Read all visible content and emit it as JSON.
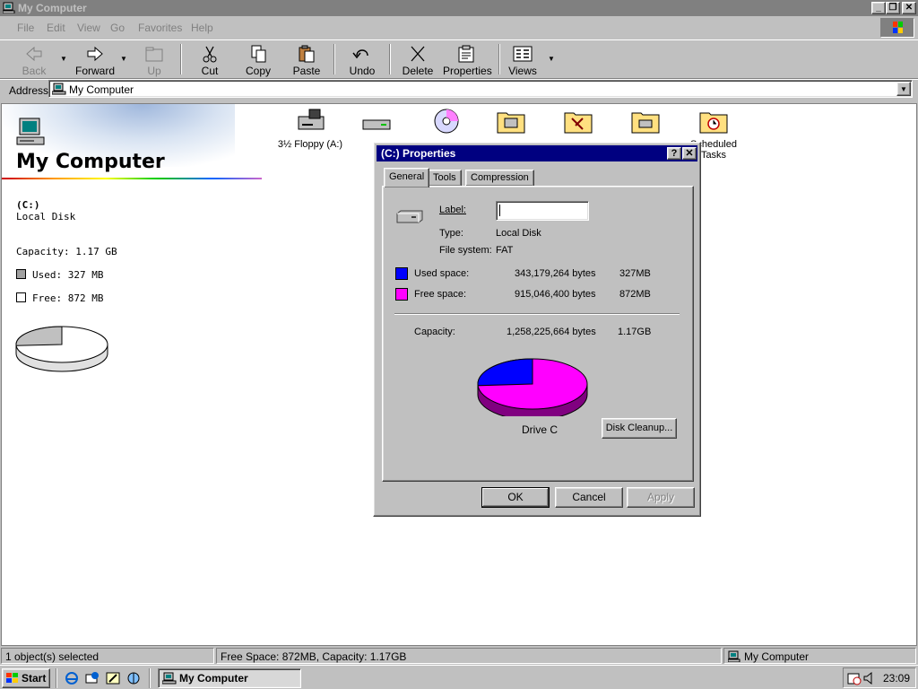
{
  "window": {
    "title": "My Computer"
  },
  "menu": {
    "items": [
      {
        "label": "File"
      },
      {
        "label": "Edit"
      },
      {
        "label": "View"
      },
      {
        "label": "Go"
      },
      {
        "label": "Favorites"
      },
      {
        "label": "Help"
      }
    ]
  },
  "toolbar": {
    "back": "Back",
    "forward": "Forward",
    "up": "Up",
    "cut": "Cut",
    "copy": "Copy",
    "paste": "Paste",
    "undo": "Undo",
    "delete": "Delete",
    "properties": "Properties",
    "views": "Views"
  },
  "address": {
    "label": "Address",
    "value": "My Computer"
  },
  "content": {
    "title": "My Computer",
    "drive_name": "(C:)",
    "drive_type": "Local Disk",
    "capacity": "Capacity: 1.17 GB",
    "used": "Used: 327 MB",
    "free": "Free: 872 MB",
    "used_fraction": 0.26,
    "icons": [
      {
        "label": "3½ Floppy (A:)",
        "icon": "floppy-drive-icon"
      },
      {
        "label": "",
        "icon": "hard-disk-icon"
      },
      {
        "label": "",
        "icon": "cd-rom-icon"
      },
      {
        "label": "",
        "icon": "printers-folder-icon"
      },
      {
        "label": "",
        "icon": "control-panel-folder-icon"
      },
      {
        "label": "",
        "icon": "dial-up-networking-folder-icon"
      },
      {
        "label": "Scheduled Tasks",
        "icon": "scheduled-tasks-folder-icon"
      }
    ]
  },
  "dialog": {
    "title": "(C:) Properties",
    "tabs": [
      {
        "label": "General"
      },
      {
        "label": "Tools"
      },
      {
        "label": "Compression"
      }
    ],
    "label_caption": "Label:",
    "label_value": "",
    "type_caption": "Type:",
    "type_value": "Local Disk",
    "fs_caption": "File system:",
    "fs_value": "FAT",
    "used_caption": "Used space:",
    "used_bytes": "343,179,264 bytes",
    "used_size": "327MB",
    "free_caption": "Free space:",
    "free_bytes": "915,046,400 bytes",
    "free_size": "872MB",
    "capacity_caption": "Capacity:",
    "capacity_bytes": "1,258,225,664 bytes",
    "capacity_size": "1.17GB",
    "drive_caption": "Drive C",
    "cleanup": "Disk Cleanup...",
    "ok": "OK",
    "cancel": "Cancel",
    "apply": "Apply",
    "used_color": "#0000ff",
    "free_color": "#ff00ff"
  },
  "status": {
    "selected": "1 object(s) selected",
    "space": "Free Space: 872MB, Capacity: 1.17GB",
    "location": "My Computer"
  },
  "taskbar": {
    "start": "Start",
    "task": "My Computer",
    "clock": "23:09"
  }
}
